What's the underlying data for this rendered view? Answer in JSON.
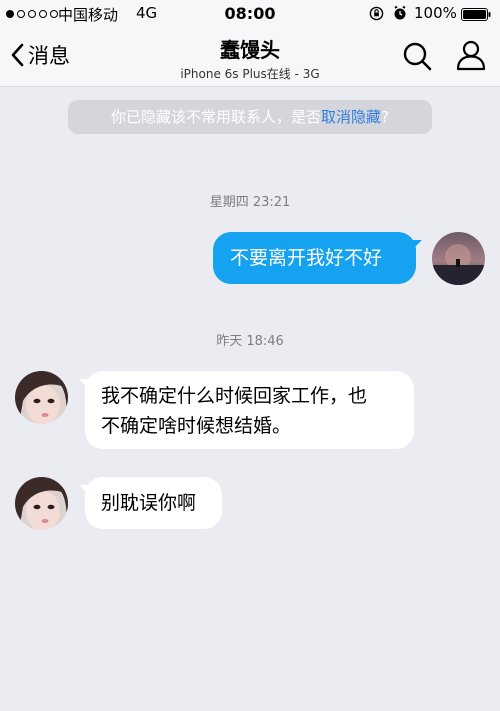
{
  "status_bar": {
    "carrier": "中国移动",
    "network": "4G",
    "time": "08:00",
    "battery": "100%",
    "signal_dots_filled": 1,
    "signal_dots_total": 5
  },
  "nav": {
    "back_label": "消息",
    "title": "蠢馒头",
    "subtitle": "iPhone 6s Plus在线 - 3G"
  },
  "notice": {
    "text": "你已隐藏该不常用联系人，是否",
    "link": "取消隐藏",
    "suffix": "?"
  },
  "conversation": [
    {
      "type": "timestamp",
      "text": "星期四 23:21"
    },
    {
      "type": "message",
      "direction": "outgoing",
      "text": "不要离开我好不好"
    },
    {
      "type": "timestamp",
      "text": "昨天 18:46"
    },
    {
      "type": "message",
      "direction": "incoming",
      "lines": [
        "我不确定什么时候回家工作，也",
        "不确定啥时候想结婚。"
      ]
    },
    {
      "type": "message",
      "direction": "incoming",
      "text": "别耽误你啊"
    }
  ],
  "colors": {
    "background": "#ebebf2",
    "outgoing_bubble": "#15a2f0",
    "incoming_bubble": "#ffffff",
    "link": "#2f7fde"
  }
}
